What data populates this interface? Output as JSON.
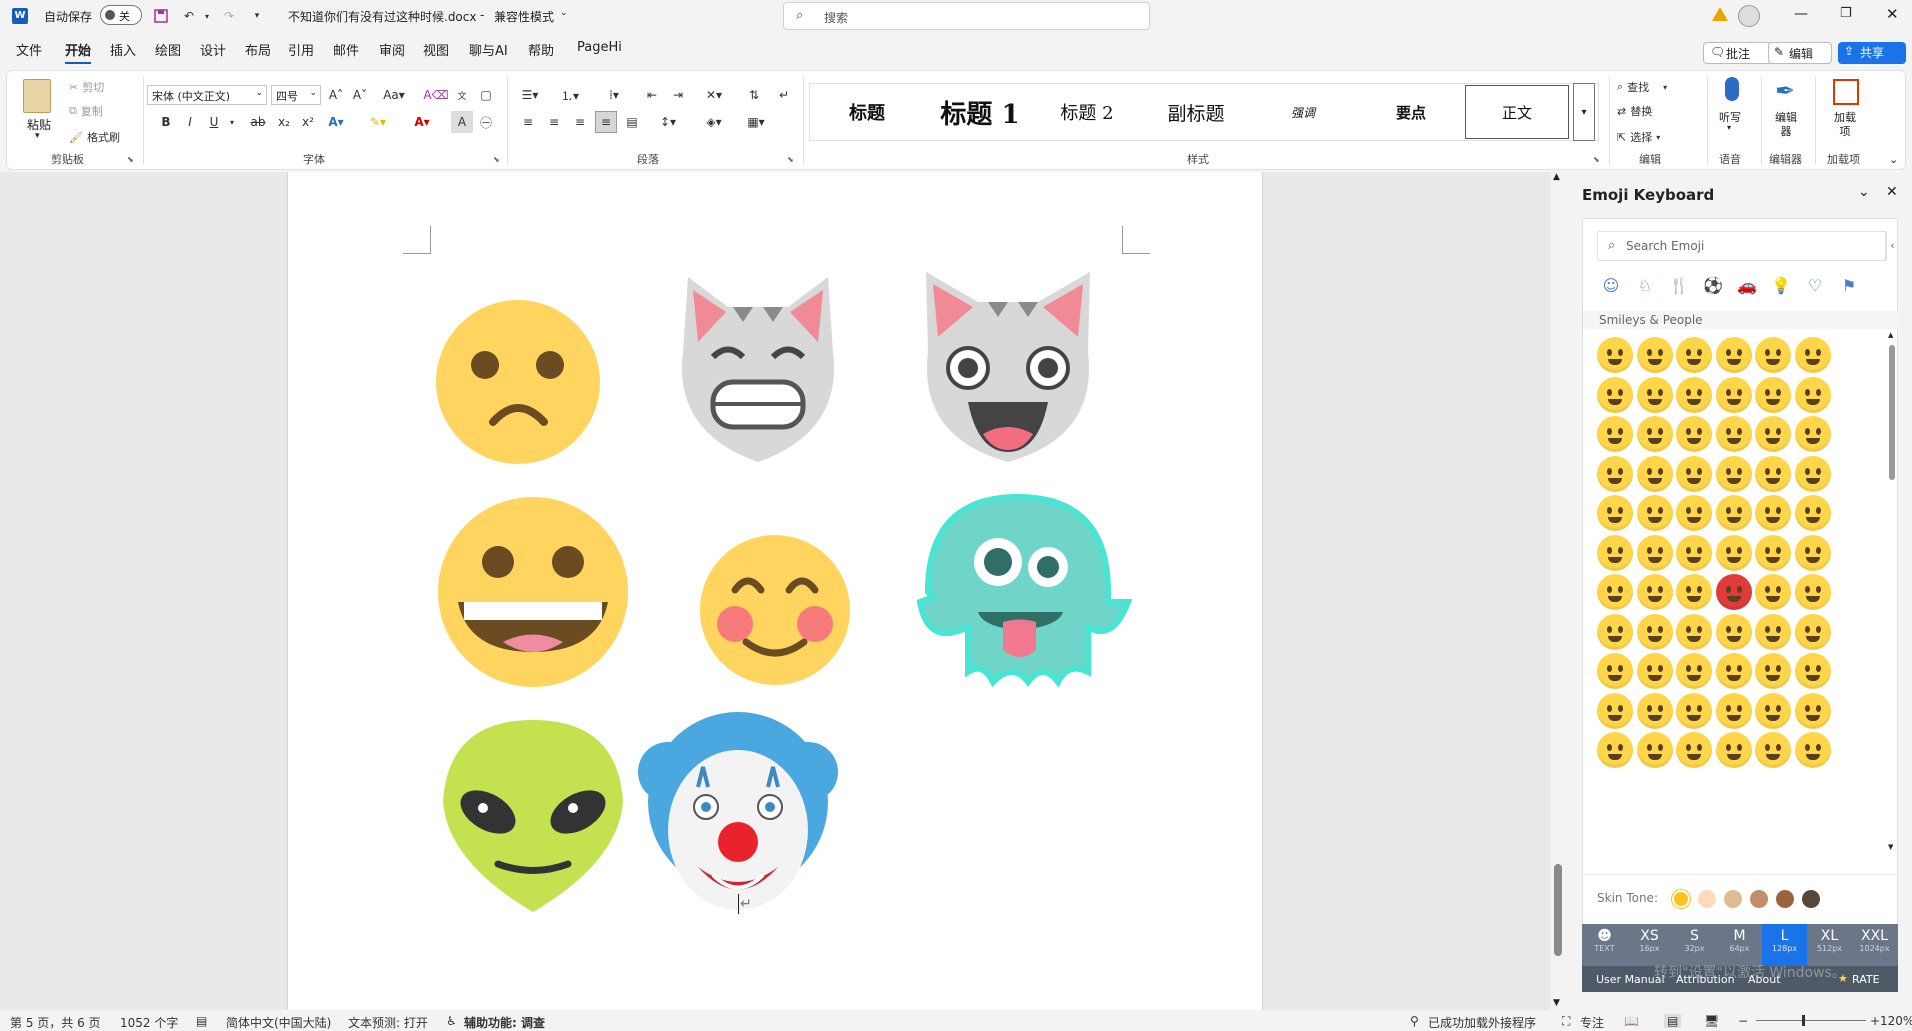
{
  "titlebar": {
    "autosave_label": "自动保存",
    "autosave_state": "关",
    "doc_title": "不知道你们有没有过这种时候.docx",
    "mode": "兼容性模式",
    "search_placeholder": "搜索"
  },
  "menu": {
    "tabs": [
      "文件",
      "开始",
      "插入",
      "绘图",
      "设计",
      "布局",
      "引用",
      "邮件",
      "审阅",
      "视图",
      "聊与AI",
      "帮助",
      "PageHi"
    ],
    "comment_btn": "批注",
    "edit_btn": "编辑",
    "share_btn": "共享"
  },
  "ribbon": {
    "clipboard": {
      "paste": "粘贴",
      "cut": "剪切",
      "copy": "复制",
      "format_painter": "格式刷",
      "label": "剪贴板"
    },
    "font": {
      "name": "宋体 (中文正文)",
      "size": "四号",
      "label": "字体"
    },
    "paragraph": {
      "label": "段落"
    },
    "styles": {
      "items": [
        "标题",
        "标题 1",
        "标题 2",
        "副标题",
        "强调",
        "要点",
        "正文"
      ],
      "label": "样式"
    },
    "editing": {
      "find": "查找",
      "replace": "替换",
      "select": "选择",
      "label": "编辑"
    },
    "voice": {
      "dictate": "听写",
      "label": "语音"
    },
    "editor": {
      "name": "编辑器",
      "label": "编辑器"
    },
    "addins": {
      "name": "加载项",
      "label": "加载项"
    }
  },
  "panel": {
    "title": "Emoji Keyboard",
    "search_placeholder": "Search Emoji",
    "section": "Smileys & People",
    "skin_tone_label": "Skin Tone:",
    "sizes": [
      {
        "label": "TEXT",
        "px": ""
      },
      {
        "label": "XS",
        "px": "16px"
      },
      {
        "label": "S",
        "px": "32px"
      },
      {
        "label": "M",
        "px": "64px"
      },
      {
        "label": "L",
        "px": "128px"
      },
      {
        "label": "XL",
        "px": "512px"
      },
      {
        "label": "XXL",
        "px": "1024px"
      }
    ],
    "footer": {
      "manual": "User Manual",
      "attribution": "Attribution",
      "about": "About",
      "rate": "RATE"
    },
    "watermark": "转到\"设置\"以激活 Windows。"
  },
  "status": {
    "page": "第 5 页，共 6 页",
    "words": "1052 个字",
    "language": "简体中文(中国大陆)",
    "predict": "文本预测: 打开",
    "access": "辅助功能: 调查",
    "addins": "已成功加载外接程序",
    "focus": "专注",
    "zoom": "120%"
  },
  "colors": {
    "accent": "#185abd",
    "share": "#1a73e8",
    "emoji_yellow": "#ffd54a"
  }
}
